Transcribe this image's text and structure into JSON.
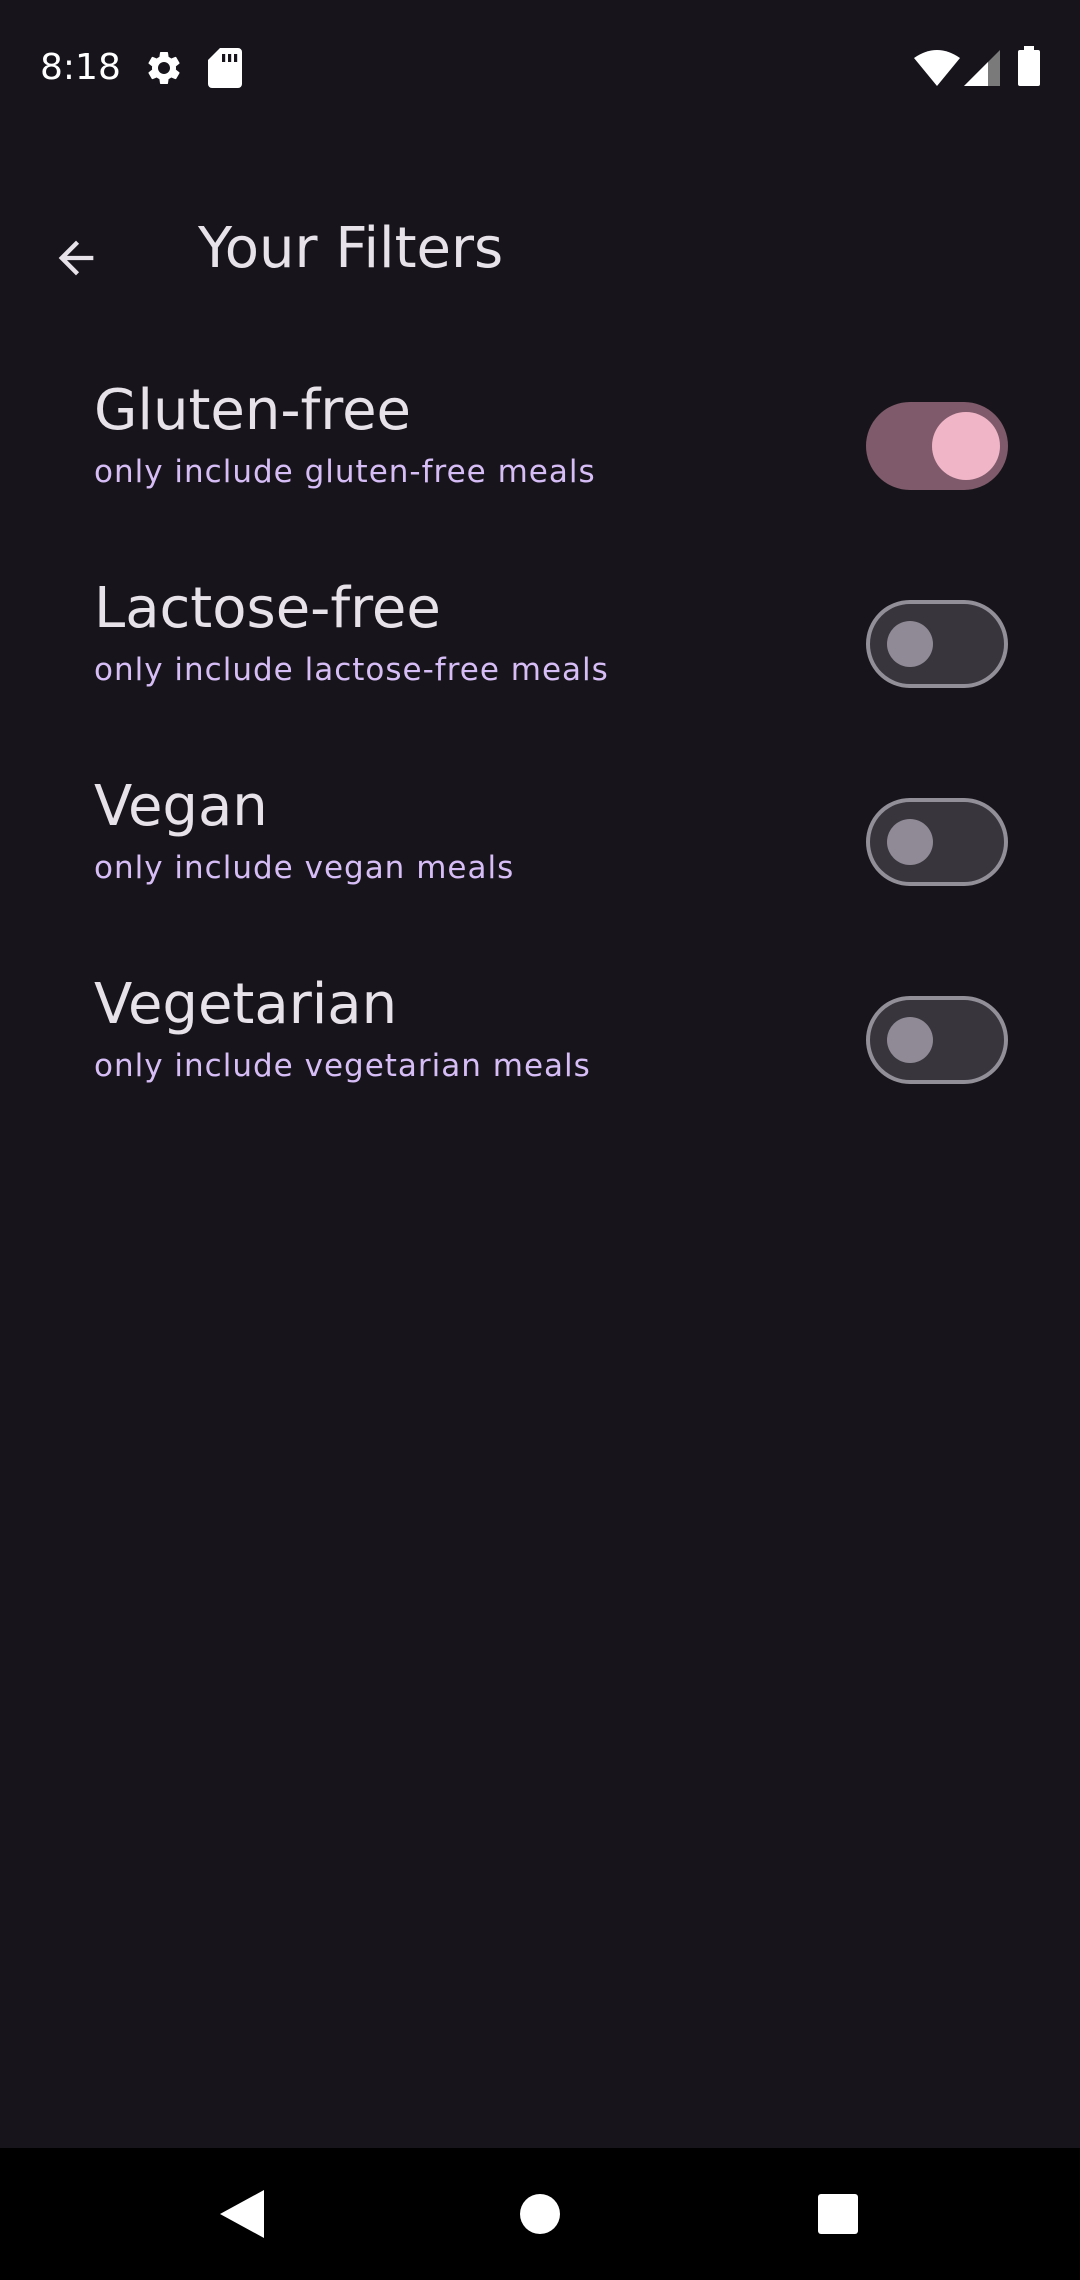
{
  "status_bar": {
    "time": "8:18",
    "left_icons": [
      "gear-icon",
      "sd-card-icon"
    ],
    "right_icons": [
      "wifi-icon",
      "signal-icon",
      "battery-icon"
    ]
  },
  "app_bar": {
    "back_icon": "arrow-back-icon",
    "title": "Your Filters"
  },
  "filters": [
    {
      "title": "Gluten-free",
      "subtitle": "only include gluten-free meals",
      "enabled": true
    },
    {
      "title": "Lactose-free",
      "subtitle": "only include lactose-free meals",
      "enabled": false
    },
    {
      "title": "Vegan",
      "subtitle": "only include vegan meals",
      "enabled": false
    },
    {
      "title": "Vegetarian",
      "subtitle": "only include vegetarian meals",
      "enabled": false
    }
  ],
  "nav_bar": {
    "icons": [
      "back-triangle-icon",
      "home-circle-icon",
      "recents-square-icon"
    ]
  },
  "colors": {
    "background": "#17151b",
    "title_text": "#e7e1e9",
    "subtitle_text": "#d6bdf6",
    "switch_on_track": "#7e5a6a",
    "switch_on_thumb": "#f0b5c7",
    "switch_off_track": "#38353d",
    "switch_off_border": "#938f99",
    "nav_bar": "#000000"
  }
}
